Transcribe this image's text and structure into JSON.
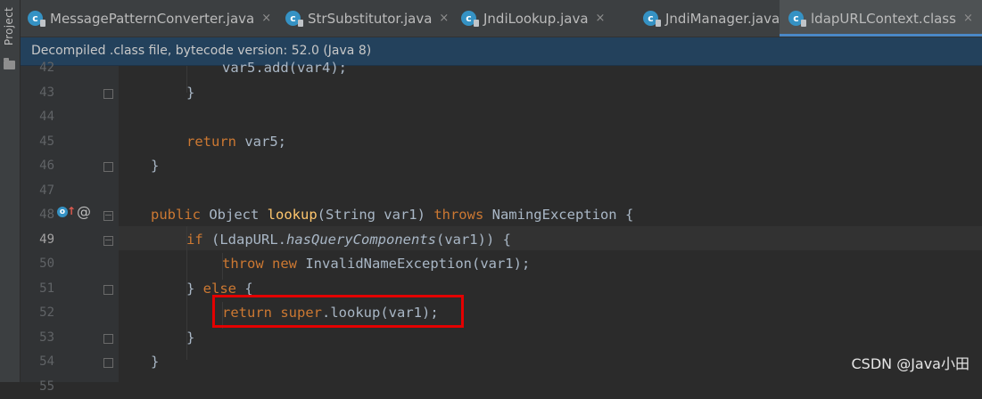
{
  "sidebar": {
    "label": "Project"
  },
  "tabs": [
    {
      "label": "MessagePatternConverter.java",
      "close": "×",
      "icon": "c"
    },
    {
      "label": "StrSubstitutor.java",
      "close": "×",
      "icon": "c"
    },
    {
      "label": "JndiLookup.java",
      "close": "×",
      "icon": "c"
    },
    {
      "label": "JndiManager.java",
      "close": "×",
      "icon": "c"
    },
    {
      "label": "ldapURLContext.class",
      "close": "×",
      "icon": "c"
    }
  ],
  "banner": {
    "text": "Decompiled .class file, bytecode version: 52.0 (Java 8)"
  },
  "editor": {
    "line_numbers": [
      "42",
      "43",
      "44",
      "45",
      "46",
      "47",
      "48",
      "49",
      "50",
      "51",
      "52",
      "53",
      "54",
      "55"
    ],
    "current_line": "49",
    "code": {
      "l42": "var5.add(var4);",
      "l43": "}",
      "l45_kw": "return",
      "l45_rest": " var5;",
      "l46": "}",
      "l48_public": "public",
      "l48_object": " Object ",
      "l48_lookup": "lookup",
      "l48_params": "(String var1) ",
      "l48_throws": "throws",
      "l48_rest": " NamingException {",
      "l49_if": "if",
      "l49_pre": " (LdapURL.",
      "l49_method": "hasQueryComponents",
      "l49_post": "(var1)) {",
      "l50_throw": "throw",
      "l50_new": "new",
      "l50_rest": " InvalidNameException(var1);",
      "l51_close": "} ",
      "l51_else": "else",
      "l51_brace": " {",
      "l52_return": "return",
      "l52_super": "super",
      "l52_rest": ".lookup(var1);",
      "l53": "}",
      "l54": "}"
    },
    "gutter_icons": {
      "implements": "o",
      "up_arrow": "↑",
      "override": "@"
    }
  },
  "watermark": "CSDN @Java小田",
  "colors": {
    "keyword": "#cc7832",
    "method": "#ffc66d",
    "text": "#a9b7c6",
    "highlight_box": "#e30000",
    "banner_bg": "#23415c"
  }
}
